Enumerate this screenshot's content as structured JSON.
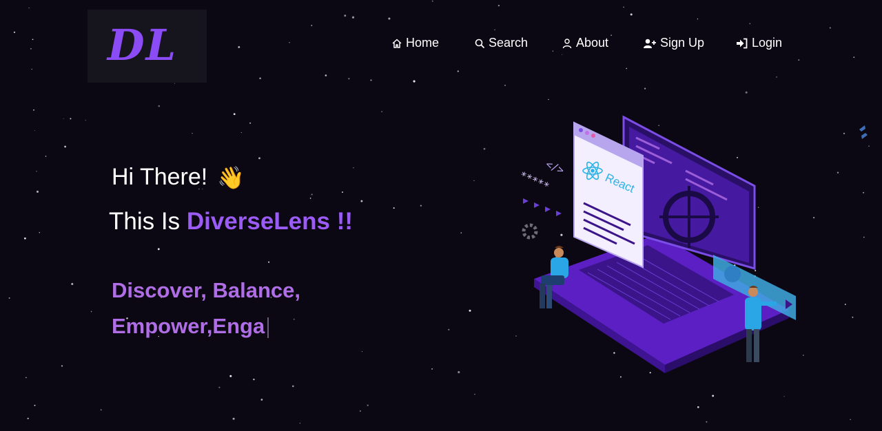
{
  "logo": {
    "text": "DL"
  },
  "nav": {
    "items": [
      {
        "label": "Home",
        "icon": "home-icon"
      },
      {
        "label": "Search",
        "icon": "search-icon"
      },
      {
        "label": "About",
        "icon": "user-icon"
      },
      {
        "label": "Sign Up",
        "icon": "user-plus-icon"
      },
      {
        "label": "Login",
        "icon": "login-icon"
      }
    ]
  },
  "hero": {
    "greeting": "Hi There!",
    "wave_emoji": "👋",
    "intro_prefix": "This Is",
    "brand_name": "DiverseLens !!",
    "tagline_line1": "Discover, Balance,",
    "tagline_line2": "Empower,Enga"
  },
  "illustration": {
    "react_label": "React",
    "code_tag": "</>",
    "password_mask": "*****"
  },
  "colors": {
    "background": "#0c0813",
    "accent": "#9b5cf6",
    "tagline": "#b06ee6",
    "logo": "#8b4cf5"
  }
}
